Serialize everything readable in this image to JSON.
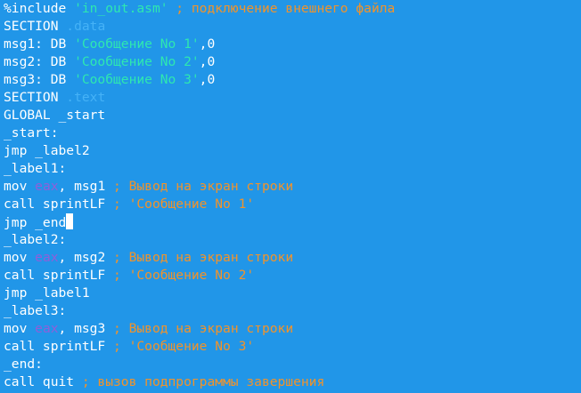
{
  "editor": {
    "lines": [
      [
        {
          "t": "plain",
          "v": "%include "
        },
        {
          "t": "string",
          "v": "'in_out.asm'"
        },
        {
          "t": "comment",
          "v": " ; подключение внешнего файла"
        }
      ],
      [
        {
          "t": "plain",
          "v": "SECTION "
        },
        {
          "t": "section",
          "v": ".data"
        }
      ],
      [
        {
          "t": "plain",
          "v": "msg1: DB "
        },
        {
          "t": "string",
          "v": "'Сообщение No 1'"
        },
        {
          "t": "plain",
          "v": ",0"
        }
      ],
      [
        {
          "t": "plain",
          "v": "msg2: DB "
        },
        {
          "t": "string",
          "v": "'Сообщение No 2'"
        },
        {
          "t": "plain",
          "v": ",0"
        }
      ],
      [
        {
          "t": "plain",
          "v": "msg3: DB "
        },
        {
          "t": "string",
          "v": "'Сообщение No 3'"
        },
        {
          "t": "plain",
          "v": ",0"
        }
      ],
      [
        {
          "t": "plain",
          "v": "SECTION "
        },
        {
          "t": "section",
          "v": ".text"
        }
      ],
      [
        {
          "t": "plain",
          "v": "GLOBAL _start"
        }
      ],
      [
        {
          "t": "plain",
          "v": "_start:"
        }
      ],
      [
        {
          "t": "plain",
          "v": "jmp _label2"
        }
      ],
      [
        {
          "t": "plain",
          "v": "_label1:"
        }
      ],
      [
        {
          "t": "plain",
          "v": "mov "
        },
        {
          "t": "register",
          "v": "eax"
        },
        {
          "t": "plain",
          "v": ", msg1"
        },
        {
          "t": "comment",
          "v": " ; Вывод на экран строки"
        }
      ],
      [
        {
          "t": "plain",
          "v": "call sprintLF"
        },
        {
          "t": "comment",
          "v": " ; 'Сообщение No 1'"
        }
      ],
      [
        {
          "t": "plain",
          "v": "jmp _end"
        },
        {
          "t": "cursor",
          "v": ""
        }
      ],
      [
        {
          "t": "plain",
          "v": "_label2:"
        }
      ],
      [
        {
          "t": "plain",
          "v": "mov "
        },
        {
          "t": "register",
          "v": "eax"
        },
        {
          "t": "plain",
          "v": ", msg2"
        },
        {
          "t": "comment",
          "v": " ; Вывод на экран строки"
        }
      ],
      [
        {
          "t": "plain",
          "v": "call sprintLF"
        },
        {
          "t": "comment",
          "v": " ; 'Сообщение No 2'"
        }
      ],
      [
        {
          "t": "plain",
          "v": "jmp _label1"
        }
      ],
      [
        {
          "t": "plain",
          "v": "_label3:"
        }
      ],
      [
        {
          "t": "plain",
          "v": "mov "
        },
        {
          "t": "register",
          "v": "eax"
        },
        {
          "t": "plain",
          "v": ", msg3"
        },
        {
          "t": "comment",
          "v": " ; Вывод на экран строки"
        }
      ],
      [
        {
          "t": "plain",
          "v": "call sprintLF"
        },
        {
          "t": "comment",
          "v": " ; 'Сообщение No 3'"
        }
      ],
      [
        {
          "t": "plain",
          "v": "_end:"
        }
      ],
      [
        {
          "t": "plain",
          "v": "call quit"
        },
        {
          "t": "comment",
          "v": " ; вызов подпрограммы завершения"
        }
      ]
    ]
  },
  "colors": {
    "background": "#2196e8",
    "plain": "#ffffff",
    "string": "#2ee8b0",
    "comment": "#f2932a",
    "register": "#8f5fd9",
    "section": "#45b2f7"
  }
}
